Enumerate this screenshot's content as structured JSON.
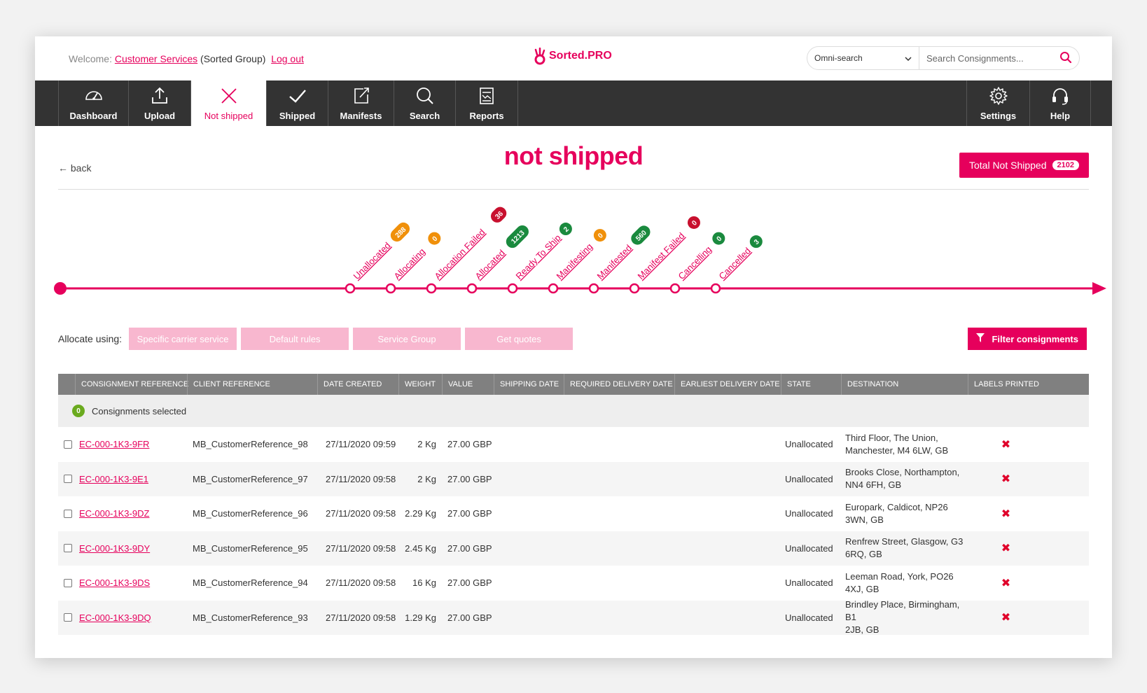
{
  "header": {
    "welcome_prefix": "Welcome:",
    "user": "Customer Services",
    "group": "(Sorted Group)",
    "logout": "Log out",
    "logo_text": "Sorted.PRO",
    "search_mode": "Omni-search",
    "search_placeholder": "Search Consignments..."
  },
  "nav": {
    "items": [
      {
        "label": "Dashboard",
        "icon": "speedometer-icon"
      },
      {
        "label": "Upload",
        "icon": "upload-icon"
      },
      {
        "label": "Not shipped",
        "icon": "x-icon"
      },
      {
        "label": "Shipped",
        "icon": "check-icon"
      },
      {
        "label": "Manifests",
        "icon": "export-icon"
      },
      {
        "label": "Search",
        "icon": "search-icon"
      },
      {
        "label": "Reports",
        "icon": "report-icon"
      }
    ],
    "right": [
      {
        "label": "Settings",
        "icon": "gear-icon"
      },
      {
        "label": "Help",
        "icon": "headset-icon"
      }
    ]
  },
  "page": {
    "back": "back",
    "title": "not shipped",
    "total_label": "Total Not Shipped",
    "total_count": "2102"
  },
  "timeline": {
    "stages": [
      {
        "label": "Unallocated",
        "count": "288",
        "color": "#f0900a"
      },
      {
        "label": "Allocating",
        "count": "0",
        "color": "#f0900a"
      },
      {
        "label": "Allocation Failed",
        "count": "36",
        "color": "#c8102e"
      },
      {
        "label": "Allocated",
        "count": "1213",
        "color": "#1a8a3e"
      },
      {
        "label": "Ready To Ship",
        "count": "2",
        "color": "#1a8a3e"
      },
      {
        "label": "Manifesting",
        "count": "0",
        "color": "#f0900a"
      },
      {
        "label": "Manifested",
        "count": "560",
        "color": "#1a8a3e"
      },
      {
        "label": "Manifest Failed",
        "count": "0",
        "color": "#c8102e"
      },
      {
        "label": "Cancelling",
        "count": "0",
        "color": "#1a8a3e"
      },
      {
        "label": "Cancelled",
        "count": "3",
        "color": "#1a8a3e"
      }
    ]
  },
  "allocate": {
    "label": "Allocate using:",
    "buttons": [
      "Specific carrier service",
      "Default rules",
      "Service Group",
      "Get quotes"
    ],
    "filter": "Filter consignments"
  },
  "table": {
    "headers": [
      "CONSIGNMENT REFERENCE",
      "CLIENT REFERENCE",
      "DATE CREATED",
      "WEIGHT",
      "VALUE",
      "SHIPPING DATE",
      "REQUIRED DELIVERY DATE",
      "EARLIEST DELIVERY DATE",
      "STATE",
      "DESTINATION",
      "LABELS PRINTED"
    ],
    "selected_count": "0",
    "selected_label": "Consignments selected",
    "rows": [
      {
        "ref": "EC-000-1K3-9FR",
        "client": "MB_CustomerReference_98",
        "date": "27/11/2020 09:59",
        "weight": "2 Kg",
        "value": "27.00 GBP",
        "state": "Unallocated",
        "dest1": "Third Floor, The Union,",
        "dest2": "Manchester, M4 6LW, GB"
      },
      {
        "ref": "EC-000-1K3-9E1",
        "client": "MB_CustomerReference_97",
        "date": "27/11/2020 09:58",
        "weight": "2 Kg",
        "value": "27.00 GBP",
        "state": "Unallocated",
        "dest1": "Brooks Close, Northampton,",
        "dest2": "NN4 6FH, GB"
      },
      {
        "ref": "EC-000-1K3-9DZ",
        "client": "MB_CustomerReference_96",
        "date": "27/11/2020 09:58",
        "weight": "2.29 Kg",
        "value": "27.00 GBP",
        "state": "Unallocated",
        "dest1": "Europark, Caldicot, NP26",
        "dest2": "3WN, GB"
      },
      {
        "ref": "EC-000-1K3-9DY",
        "client": "MB_CustomerReference_95",
        "date": "27/11/2020 09:58",
        "weight": "2.45 Kg",
        "value": "27.00 GBP",
        "state": "Unallocated",
        "dest1": "Renfrew Street, Glasgow, G3",
        "dest2": "6RQ, GB"
      },
      {
        "ref": "EC-000-1K3-9DS",
        "client": "MB_CustomerReference_94",
        "date": "27/11/2020 09:58",
        "weight": "16 Kg",
        "value": "27.00 GBP",
        "state": "Unallocated",
        "dest1": "Leeman Road, York, PO26",
        "dest2": "4XJ, GB"
      },
      {
        "ref": "EC-000-1K3-9DQ",
        "client": "MB_CustomerReference_93",
        "date": "27/11/2020 09:58",
        "weight": "1.29 Kg",
        "value": "27.00 GBP",
        "state": "Unallocated",
        "dest1": "Brindley Place, Birmingham, B1",
        "dest2": "2JB, GB"
      }
    ]
  },
  "colors": {
    "brand": "#e6005c",
    "nav_bg": "#333333",
    "header_bg": "#808080"
  }
}
